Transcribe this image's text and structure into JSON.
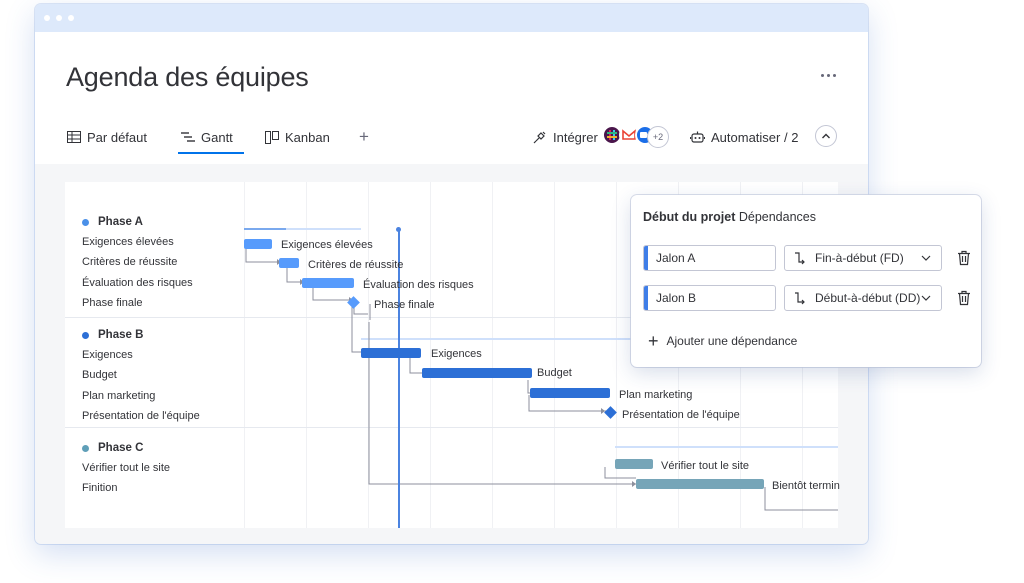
{
  "header": {
    "title": "Agenda des équipes",
    "tabs": [
      {
        "label": "Par défaut",
        "icon": "table-icon"
      },
      {
        "label": "Gantt",
        "icon": "gantt-icon"
      },
      {
        "label": "Kanban",
        "icon": "kanban-icon"
      }
    ],
    "add_tab_label": "+",
    "integrate_label": "Intégrer",
    "integrations_more": "+2",
    "automate_label": "Automatiser / 2"
  },
  "gantt": {
    "phases": [
      {
        "name": "Phase A",
        "color": "#4a90e8",
        "items": [
          "Exigences élevées",
          "Critères de réussite",
          "Évaluation des risques",
          "Phase finale"
        ]
      },
      {
        "name": "Phase B",
        "color": "#2c6fd6",
        "items": [
          "Exigences",
          "Budget",
          "Plan marketing",
          "Présentation de l'équipe"
        ]
      },
      {
        "name": "Phase C",
        "color": "#5f9fb8",
        "items": [
          "Vérifier tout le site",
          "Finition"
        ]
      }
    ],
    "bar_labels": {
      "a1": "Exigences élevées",
      "a2": "Critères de réussite",
      "a3": "Évaluation des risques",
      "a4": "Phase finale",
      "b1": "Exigences",
      "b2": "Budget",
      "b3": "Plan marketing",
      "b4": "Présentation de l'équipe",
      "c1": "Vérifier tout le site",
      "c2": "Bientôt termin"
    }
  },
  "dependencies": {
    "title_bold": "Début du projet",
    "title_rest": "Dépendances",
    "rows": [
      {
        "task": "Jalon A",
        "type": "Fin-à-début (FD)"
      },
      {
        "task": "Jalon B",
        "type": "Début-à-début (DD)"
      }
    ],
    "add_label": "Ajouter une dépendance"
  }
}
